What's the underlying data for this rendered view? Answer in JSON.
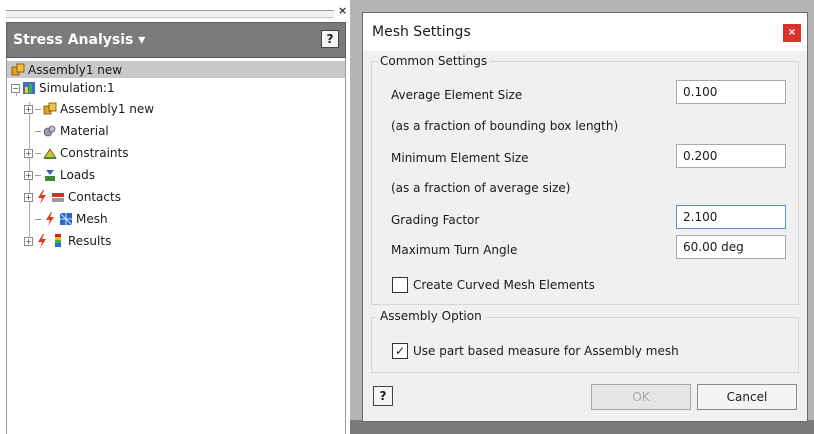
{
  "panel": {
    "close_glyph": "×",
    "title": "Stress Analysis ▾",
    "help_glyph": "?",
    "root_label": "Assembly1 new",
    "tree": {
      "simulation": "Simulation:1",
      "assembly": "Assembly1 new",
      "material": "Material",
      "constraints": "Constraints",
      "loads": "Loads",
      "contacts": "Contacts",
      "mesh": "Mesh",
      "results": "Results"
    },
    "icons": [
      "assembly-icon",
      "simulation-icon",
      "material-icon",
      "constraints-icon",
      "loads-icon",
      "warning-bolt-icon",
      "contacts-icon",
      "mesh-icon",
      "results-icon"
    ]
  },
  "dialog": {
    "title": "Mesh Settings",
    "close_glyph": "×",
    "common_group": "Common Settings",
    "avg_label": "Average Element Size",
    "avg_value": "0.100",
    "avg_note": "(as a fraction of bounding box length)",
    "min_label": "Minimum Element Size",
    "min_value": "0.200",
    "min_note": "(as a fraction of average size)",
    "grading_label": "Grading Factor",
    "grading_value": "2.100",
    "turn_label": "Maximum Turn Angle",
    "turn_value": "60.00 deg",
    "curved_label": "Create Curved Mesh Elements",
    "curved_checked": false,
    "assembly_group": "Assembly Option",
    "partbased_label": "Use part based measure for Assembly mesh",
    "partbased_checked": true,
    "check_glyph": "✓",
    "help_glyph": "?",
    "ok_label": "OK",
    "cancel_label": "Cancel"
  },
  "colors": {
    "panel_header": "#7b7b7b",
    "close_red": "#d9342b",
    "dialog_bg": "#f0f0f0",
    "focus_border": "#5a8fd0"
  }
}
